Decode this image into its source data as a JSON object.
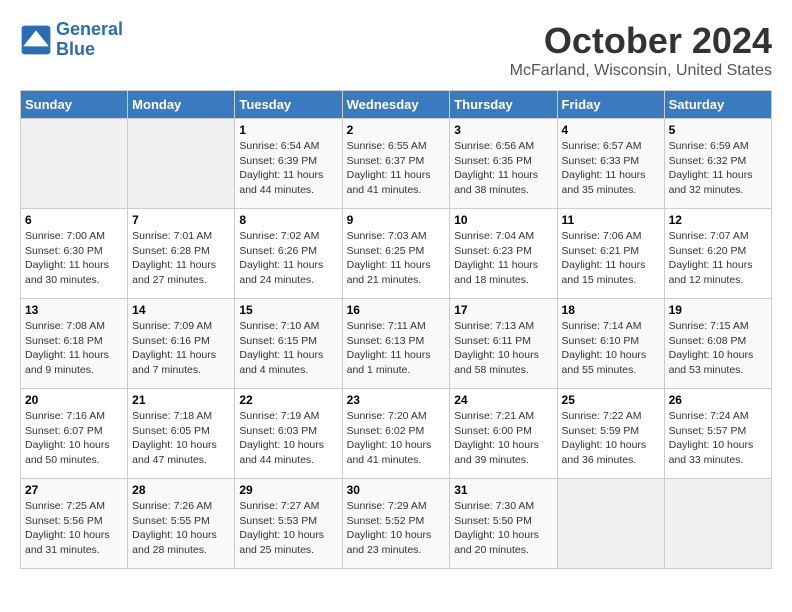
{
  "logo": {
    "text_general": "General",
    "text_blue": "Blue"
  },
  "title": "October 2024",
  "subtitle": "McFarland, Wisconsin, United States",
  "days_header": [
    "Sunday",
    "Monday",
    "Tuesday",
    "Wednesday",
    "Thursday",
    "Friday",
    "Saturday"
  ],
  "weeks": [
    [
      {
        "num": "",
        "info": ""
      },
      {
        "num": "",
        "info": ""
      },
      {
        "num": "1",
        "info": "Sunrise: 6:54 AM\nSunset: 6:39 PM\nDaylight: 11 hours and 44 minutes."
      },
      {
        "num": "2",
        "info": "Sunrise: 6:55 AM\nSunset: 6:37 PM\nDaylight: 11 hours and 41 minutes."
      },
      {
        "num": "3",
        "info": "Sunrise: 6:56 AM\nSunset: 6:35 PM\nDaylight: 11 hours and 38 minutes."
      },
      {
        "num": "4",
        "info": "Sunrise: 6:57 AM\nSunset: 6:33 PM\nDaylight: 11 hours and 35 minutes."
      },
      {
        "num": "5",
        "info": "Sunrise: 6:59 AM\nSunset: 6:32 PM\nDaylight: 11 hours and 32 minutes."
      }
    ],
    [
      {
        "num": "6",
        "info": "Sunrise: 7:00 AM\nSunset: 6:30 PM\nDaylight: 11 hours and 30 minutes."
      },
      {
        "num": "7",
        "info": "Sunrise: 7:01 AM\nSunset: 6:28 PM\nDaylight: 11 hours and 27 minutes."
      },
      {
        "num": "8",
        "info": "Sunrise: 7:02 AM\nSunset: 6:26 PM\nDaylight: 11 hours and 24 minutes."
      },
      {
        "num": "9",
        "info": "Sunrise: 7:03 AM\nSunset: 6:25 PM\nDaylight: 11 hours and 21 minutes."
      },
      {
        "num": "10",
        "info": "Sunrise: 7:04 AM\nSunset: 6:23 PM\nDaylight: 11 hours and 18 minutes."
      },
      {
        "num": "11",
        "info": "Sunrise: 7:06 AM\nSunset: 6:21 PM\nDaylight: 11 hours and 15 minutes."
      },
      {
        "num": "12",
        "info": "Sunrise: 7:07 AM\nSunset: 6:20 PM\nDaylight: 11 hours and 12 minutes."
      }
    ],
    [
      {
        "num": "13",
        "info": "Sunrise: 7:08 AM\nSunset: 6:18 PM\nDaylight: 11 hours and 9 minutes."
      },
      {
        "num": "14",
        "info": "Sunrise: 7:09 AM\nSunset: 6:16 PM\nDaylight: 11 hours and 7 minutes."
      },
      {
        "num": "15",
        "info": "Sunrise: 7:10 AM\nSunset: 6:15 PM\nDaylight: 11 hours and 4 minutes."
      },
      {
        "num": "16",
        "info": "Sunrise: 7:11 AM\nSunset: 6:13 PM\nDaylight: 11 hours and 1 minute."
      },
      {
        "num": "17",
        "info": "Sunrise: 7:13 AM\nSunset: 6:11 PM\nDaylight: 10 hours and 58 minutes."
      },
      {
        "num": "18",
        "info": "Sunrise: 7:14 AM\nSunset: 6:10 PM\nDaylight: 10 hours and 55 minutes."
      },
      {
        "num": "19",
        "info": "Sunrise: 7:15 AM\nSunset: 6:08 PM\nDaylight: 10 hours and 53 minutes."
      }
    ],
    [
      {
        "num": "20",
        "info": "Sunrise: 7:16 AM\nSunset: 6:07 PM\nDaylight: 10 hours and 50 minutes."
      },
      {
        "num": "21",
        "info": "Sunrise: 7:18 AM\nSunset: 6:05 PM\nDaylight: 10 hours and 47 minutes."
      },
      {
        "num": "22",
        "info": "Sunrise: 7:19 AM\nSunset: 6:03 PM\nDaylight: 10 hours and 44 minutes."
      },
      {
        "num": "23",
        "info": "Sunrise: 7:20 AM\nSunset: 6:02 PM\nDaylight: 10 hours and 41 minutes."
      },
      {
        "num": "24",
        "info": "Sunrise: 7:21 AM\nSunset: 6:00 PM\nDaylight: 10 hours and 39 minutes."
      },
      {
        "num": "25",
        "info": "Sunrise: 7:22 AM\nSunset: 5:59 PM\nDaylight: 10 hours and 36 minutes."
      },
      {
        "num": "26",
        "info": "Sunrise: 7:24 AM\nSunset: 5:57 PM\nDaylight: 10 hours and 33 minutes."
      }
    ],
    [
      {
        "num": "27",
        "info": "Sunrise: 7:25 AM\nSunset: 5:56 PM\nDaylight: 10 hours and 31 minutes."
      },
      {
        "num": "28",
        "info": "Sunrise: 7:26 AM\nSunset: 5:55 PM\nDaylight: 10 hours and 28 minutes."
      },
      {
        "num": "29",
        "info": "Sunrise: 7:27 AM\nSunset: 5:53 PM\nDaylight: 10 hours and 25 minutes."
      },
      {
        "num": "30",
        "info": "Sunrise: 7:29 AM\nSunset: 5:52 PM\nDaylight: 10 hours and 23 minutes."
      },
      {
        "num": "31",
        "info": "Sunrise: 7:30 AM\nSunset: 5:50 PM\nDaylight: 10 hours and 20 minutes."
      },
      {
        "num": "",
        "info": ""
      },
      {
        "num": "",
        "info": ""
      }
    ]
  ]
}
